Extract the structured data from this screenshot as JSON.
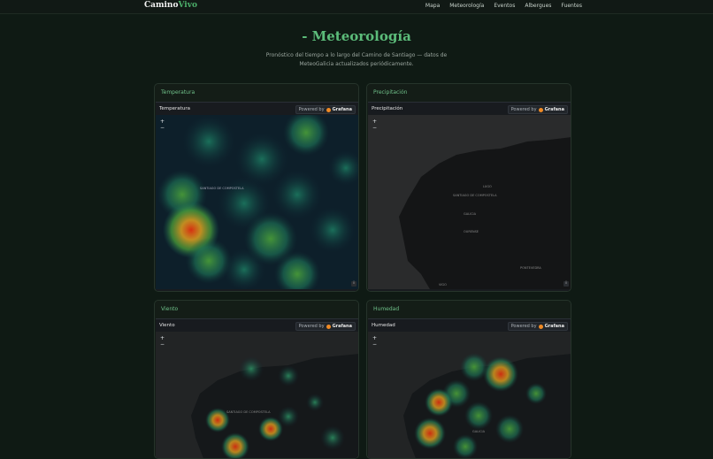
{
  "nav": {
    "brand_a": "Camino",
    "brand_b": "Vivo",
    "links": [
      "Mapa",
      "Meteorología",
      "Eventos",
      "Albergues",
      "Fuentes"
    ]
  },
  "page": {
    "title": "- Meteorología",
    "subtitle_line1": "Pronóstico del tiempo a lo largo del Camino de Santiago — datos de",
    "subtitle_line2": "MeteoGalicia actualizados periódicamente."
  },
  "cards": [
    {
      "title": "Temperatura",
      "panel": "Temperatura"
    },
    {
      "title": "Precipitación",
      "panel": "Precipitación"
    },
    {
      "title": "Viento",
      "panel": "Viento"
    },
    {
      "title": "Humedad",
      "panel": "Humedad"
    }
  ],
  "grafana": {
    "powered": "Powered by",
    "brand": "Grafana",
    "zoom_in": "+",
    "zoom_out": "−",
    "info": "i"
  },
  "map_labels": {
    "galicia": "GALICIA",
    "santiago": "SANTIAGO DE COMPOSTELA",
    "lugo": "LUGO",
    "ourense": "OURENSE",
    "pontevedra": "PONTEVEDRA",
    "vigo": "VIGO"
  },
  "colors": {
    "accent": "#5cbc7a",
    "heat_low": "#1a6b5c",
    "heat_mid": "#4fa83a",
    "heat_high": "#e0a020",
    "heat_max": "#e03010"
  }
}
